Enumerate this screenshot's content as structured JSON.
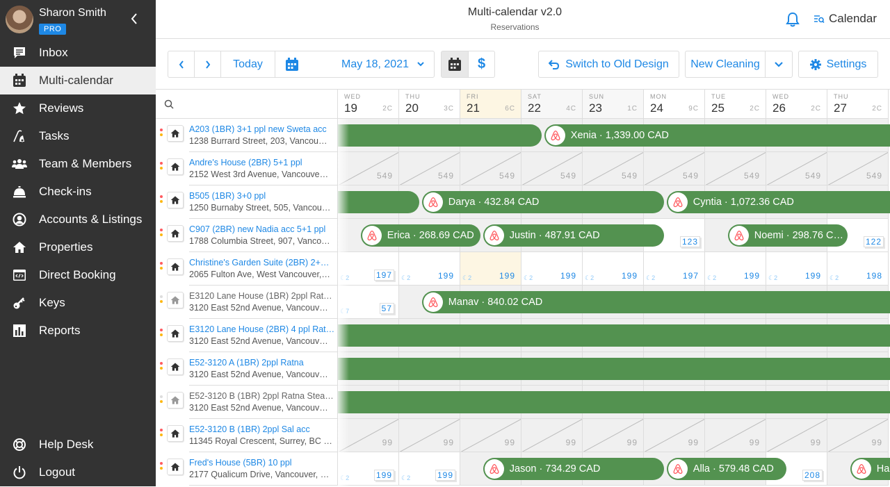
{
  "user": {
    "name": "Sharon Smith",
    "badge": "PRO"
  },
  "sidebar": {
    "items": [
      {
        "label": "Inbox",
        "icon": "inbox-icon"
      },
      {
        "label": "Multi-calendar",
        "icon": "calendar-icon",
        "active": true
      },
      {
        "label": "Reviews",
        "icon": "star-icon"
      },
      {
        "label": "Tasks",
        "icon": "vacuum-icon"
      },
      {
        "label": "Team & Members",
        "icon": "team-icon"
      },
      {
        "label": "Check-ins",
        "icon": "concierge-bell-icon"
      },
      {
        "label": "Accounts & Listings",
        "icon": "user-circle-icon"
      },
      {
        "label": "Properties",
        "icon": "home-icon"
      },
      {
        "label": "Direct Booking",
        "icon": "code-window-icon"
      },
      {
        "label": "Keys",
        "icon": "key-icon"
      },
      {
        "label": "Reports",
        "icon": "bar-chart-icon"
      }
    ],
    "bottom": [
      {
        "label": "Help Desk",
        "icon": "lifebuoy-icon"
      },
      {
        "label": "Logout",
        "icon": "power-icon"
      }
    ]
  },
  "header": {
    "title": "Multi-calendar v2.0",
    "subtitle": "Reservations",
    "calendar_link": "Calendar"
  },
  "toolbar": {
    "today": "Today",
    "date": "May 18, 2021",
    "switch_old": "Switch to Old Design",
    "new_cleaning": "New Cleaning",
    "settings": "Settings"
  },
  "search": {
    "placeholder": ""
  },
  "days": [
    {
      "dow": "WED",
      "num": "19",
      "count": "2C",
      "type": "normal"
    },
    {
      "dow": "THU",
      "num": "20",
      "count": "3C",
      "type": "normal"
    },
    {
      "dow": "FRI",
      "num": "21",
      "count": "6C",
      "type": "today"
    },
    {
      "dow": "SAT",
      "num": "22",
      "count": "4C",
      "type": "weekend"
    },
    {
      "dow": "SUN",
      "num": "23",
      "count": "1C",
      "type": "weekend"
    },
    {
      "dow": "MON",
      "num": "24",
      "count": "9C",
      "type": "normal"
    },
    {
      "dow": "TUE",
      "num": "25",
      "count": "2C",
      "type": "normal"
    },
    {
      "dow": "WED",
      "num": "26",
      "count": "2C",
      "type": "normal"
    },
    {
      "dow": "THU",
      "num": "27",
      "count": "2C",
      "type": "normal"
    }
  ],
  "properties": [
    {
      "name": "A203 (1BR) 3+1 ppl new Sweta acc",
      "address": "1238 Burrard Street, 203, Vancou…",
      "active": true
    },
    {
      "name": "Andre's House (2BR) 5+1 ppl",
      "address": "2152 West 3rd Avenue, Vancouve…",
      "active": true
    },
    {
      "name": "B505 (1BR) 3+0 ppl",
      "address": "1250 Burnaby Street, 505, Vancou…",
      "active": true
    },
    {
      "name": "C907 (2BR) new Nadia acc 5+1 ppl",
      "address": "1788 Columbia Street, 907, Vanco…",
      "active": true
    },
    {
      "name": "Christine's Garden Suite (2BR) 2+…",
      "address": "2065 Fulton Ave, West Vancouver,…",
      "active": true
    },
    {
      "name": "E3120 Lane House (1BR) 2ppl Rat…",
      "address": "3120 East 52nd Avenue, Vancouv…",
      "active": false
    },
    {
      "name": "E3120 Lane House (2BR) 4 ppl Rat…",
      "address": "3120 East 52nd Avenue, Vancouv…",
      "active": true
    },
    {
      "name": "E52-3120 A (1BR) 2ppl Ratna",
      "address": "3120 East 52nd Avenue, Vancouv…",
      "active": true
    },
    {
      "name": "E52-3120 B (1BR) 2ppl Ratna Stea…",
      "address": "3120 East 52nd Avenue, Vancouv…",
      "active": false
    },
    {
      "name": "E52-3120 B (1BR) 2ppl Sal acc",
      "address": "11345 Royal Crescent, Surrey, BC …",
      "active": true
    },
    {
      "name": "Fred's House (5BR) 10 ppl",
      "address": "2177 Qualicum Drive, Vancouver, …",
      "active": true
    }
  ],
  "blocked_prices": {
    "row1": "549",
    "row9": "99"
  },
  "cell_prices": {
    "row3": [
      {
        "col": 5,
        "price": "123"
      },
      {
        "col": 8,
        "price": "122"
      }
    ],
    "row4": [
      {
        "col": 0,
        "price": "197",
        "nights": "2"
      },
      {
        "col": 1,
        "price": "199",
        "nights": "2"
      },
      {
        "col": 2,
        "price": "199",
        "nights": "2"
      },
      {
        "col": 3,
        "price": "199",
        "nights": "2"
      },
      {
        "col": 4,
        "price": "199",
        "nights": "2"
      },
      {
        "col": 5,
        "price": "197",
        "nights": "2"
      },
      {
        "col": 6,
        "price": "199",
        "nights": "2"
      },
      {
        "col": 7,
        "price": "199",
        "nights": "2"
      },
      {
        "col": 8,
        "price": "198",
        "nights": "2"
      }
    ],
    "row5": [
      {
        "col": 0,
        "price": "57",
        "nights": "7"
      }
    ],
    "row10": [
      {
        "col": 0,
        "price": "199",
        "nights": "2"
      },
      {
        "col": 1,
        "price": "199",
        "nights": "2"
      },
      {
        "col": 7,
        "price": "208"
      }
    ]
  },
  "reservations": [
    {
      "row": 0,
      "guest": "",
      "amount": "",
      "start": -1,
      "end": 3.35
    },
    {
      "row": 0,
      "guest": "Xenia",
      "amount": "1,339.00 CAD",
      "start": 3.35,
      "end": 10
    },
    {
      "row": 2,
      "guest": "",
      "amount": "",
      "start": -1,
      "end": 1.35
    },
    {
      "row": 2,
      "guest": "Darya",
      "amount": "432.84 CAD",
      "start": 1.35,
      "end": 5.35
    },
    {
      "row": 2,
      "guest": "Cyntia",
      "amount": "1,072.36 CAD",
      "start": 5.35,
      "end": 10
    },
    {
      "row": 3,
      "guest": "Erica",
      "amount": "268.69 CAD",
      "start": 0.35,
      "end": 2.35
    },
    {
      "row": 3,
      "guest": "Justin",
      "amount": "487.91 CAD",
      "start": 2.35,
      "end": 5.35
    },
    {
      "row": 3,
      "guest": "Noemi",
      "amount": "298.76 C…",
      "start": 6.35,
      "end": 8.35
    },
    {
      "row": 5,
      "guest": "Manav",
      "amount": "840.02 CAD",
      "start": 1.35,
      "end": 10
    },
    {
      "row": 6,
      "guest": "",
      "amount": "",
      "start": -1,
      "end": 10,
      "full": true
    },
    {
      "row": 7,
      "guest": "",
      "amount": "",
      "start": -1,
      "end": 10,
      "full": true
    },
    {
      "row": 8,
      "guest": "",
      "amount": "",
      "start": -1,
      "end": 10,
      "full": true
    },
    {
      "row": 10,
      "guest": "Jason",
      "amount": "734.29 CAD",
      "start": 2.35,
      "end": 5.35
    },
    {
      "row": 10,
      "guest": "Alla",
      "amount": "579.48 CAD",
      "start": 5.35,
      "end": 7.35
    },
    {
      "row": 10,
      "guest": "Hai",
      "amount": "",
      "start": 8.35,
      "end": 10
    }
  ],
  "colors": {
    "accent": "#1e88e5",
    "booking_green": "#539250",
    "airbnb": "#ff5a5f",
    "sidebar_bg": "#333333"
  }
}
